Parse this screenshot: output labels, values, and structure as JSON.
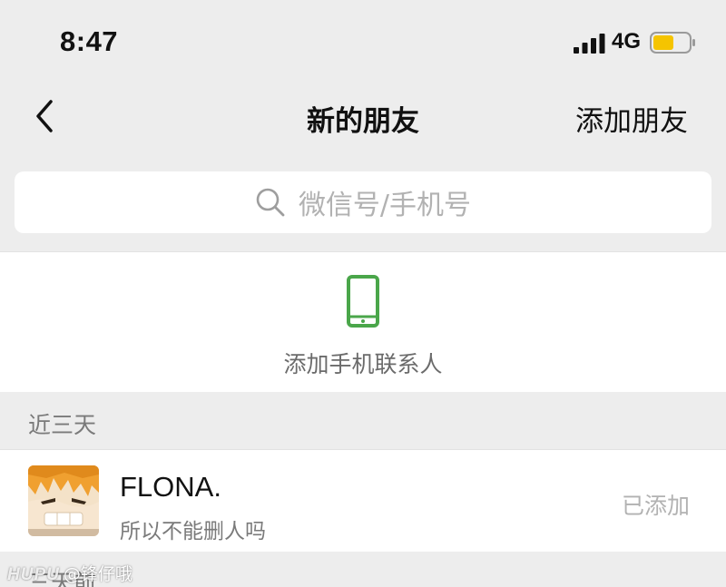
{
  "status_bar": {
    "time": "8:47",
    "network": "4G",
    "icons": {
      "signal": "signal-bars-icon",
      "battery": "battery-icon"
    },
    "battery_color": "#f5c400"
  },
  "nav": {
    "back_icon": "chevron-left-icon",
    "title": "新的朋友",
    "action_label": "添加朋友"
  },
  "search": {
    "icon": "search-icon",
    "placeholder": "微信号/手机号"
  },
  "add_contacts": {
    "icon": "phone-icon",
    "icon_color": "#4aa64a",
    "label": "添加手机联系人"
  },
  "sections": [
    {
      "label": "近三天",
      "items": [
        {
          "name": "FLONA.",
          "message": "所以不能删人吗",
          "status": "已添加",
          "avatar": "anime-avatar"
        }
      ]
    },
    {
      "label": "三天前"
    }
  ],
  "watermark": {
    "brand": "HUPU",
    "user": "@锋仔哦"
  }
}
